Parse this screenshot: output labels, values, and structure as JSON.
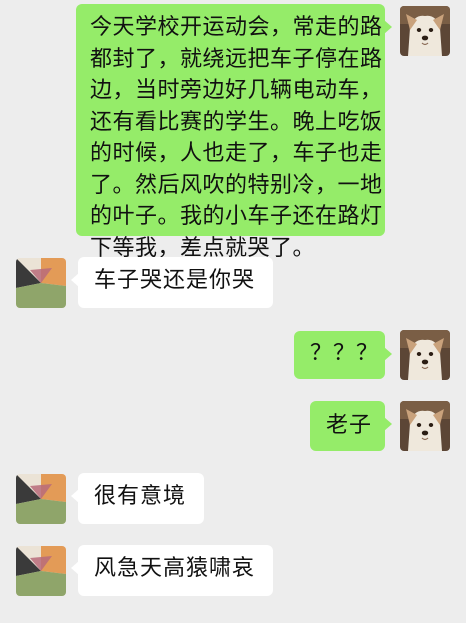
{
  "colors": {
    "background": "#ededed",
    "outgoing_bubble": "#95ec69",
    "incoming_bubble": "#ffffff"
  },
  "avatars": {
    "self": "dog-photo-avatar",
    "other": "abstract-color-block-avatar"
  },
  "messages": [
    {
      "from": "self",
      "lines": [
        "今天学校开运动会，常走的路",
        "都封了，就绕远把车子停在路",
        "边，当时旁边好几辆电动车，",
        "还有看比赛的学生。晚上吃饭",
        "的时候，人也走了，车子也走",
        "了。然后风吹的特别冷，一地",
        "的叶子。我的小车子还在路灯",
        "下等我，差点就哭了。"
      ]
    },
    {
      "from": "other",
      "text": "车子哭还是你哭"
    },
    {
      "from": "self",
      "text": "？？？"
    },
    {
      "from": "self",
      "text": "老子"
    },
    {
      "from": "other",
      "text": "很有意境"
    },
    {
      "from": "other",
      "text": "风急天高猿啸哀"
    }
  ]
}
